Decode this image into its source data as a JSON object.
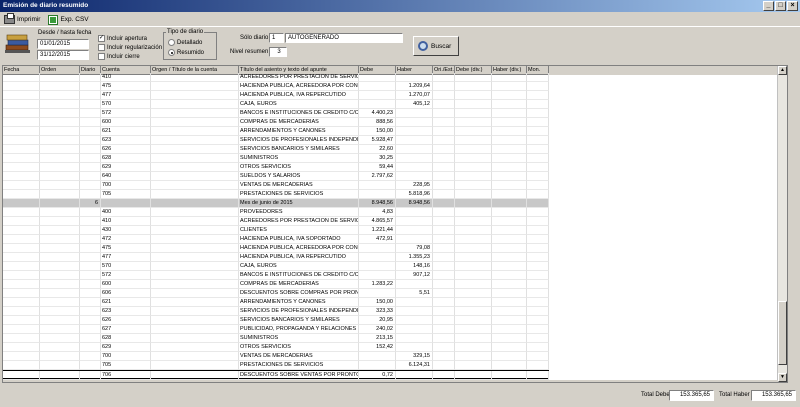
{
  "window": {
    "title": "Emisión de diario resumido"
  },
  "titlebar_buttons": [
    "_",
    "□",
    "×"
  ],
  "toolbar": {
    "print_label": "Imprimir",
    "csv_label": "Exp. CSV"
  },
  "filters": {
    "date_range_label": "Desde / hasta fecha",
    "date_from": "01/01/2015",
    "date_to": "31/12/2015",
    "include_opening_label": "Incluir apertura",
    "include_opening": true,
    "include_regularization_label": "Incluir regularización",
    "include_regularization": false,
    "include_closing_label": "Incluir cierre",
    "include_closing": false,
    "diary_type_label": "Tipo de diario",
    "type_detailed_label": "Detallado",
    "type_summary_label": "Resumido",
    "only_diary_label": "Sólo diario",
    "only_diary_value": "1",
    "only_diary_name": "AUTOGENERADO",
    "summary_level_label": "Nivel resumen",
    "summary_level_value": "3",
    "search_label": "Buscar"
  },
  "columns": [
    "Fecha",
    "Orden",
    "Diario",
    "Cuenta",
    "Orgen / Título de la cuenta",
    "Título del asiento y texto del apunte",
    "Debe",
    "Haber",
    "Ori./Est.",
    "Debe (div.)",
    "Haber (div.)",
    "Mon."
  ],
  "rows": [
    {
      "diario": "",
      "cuenta": "410",
      "titulo": "ACREEDORES POR PRESTACION DE SERVICIOS",
      "debe": "",
      "haber": "",
      "type": "normal"
    },
    {
      "diario": "",
      "cuenta": "475",
      "titulo": "HACIENDA PUBLICA, ACREEDORA POR CONCEPTOS",
      "debe": "",
      "haber": "1.209,64",
      "type": "normal"
    },
    {
      "diario": "",
      "cuenta": "477",
      "titulo": "HACIENDA PUBLICA, IVA REPERCUTIDO",
      "debe": "",
      "haber": "1.270,07",
      "type": "normal"
    },
    {
      "diario": "",
      "cuenta": "570",
      "titulo": "CAJA, EUROS",
      "debe": "",
      "haber": "405,12",
      "type": "normal"
    },
    {
      "diario": "",
      "cuenta": "572",
      "titulo": "BANCOS E INSTITUCIONES DE CREDITO C/C",
      "debe": "4.400,23",
      "haber": "",
      "type": "normal"
    },
    {
      "diario": "",
      "cuenta": "600",
      "titulo": "COMPRAS DE MERCADERIAS",
      "debe": "888,56",
      "haber": "",
      "type": "normal"
    },
    {
      "diario": "",
      "cuenta": "621",
      "titulo": "ARRENDAMIENTOS Y CANONES",
      "debe": "150,00",
      "haber": "",
      "type": "normal"
    },
    {
      "diario": "",
      "cuenta": "623",
      "titulo": "SERVICIOS DE PROFESIONALES INDEPENDIENTES",
      "debe": "5.928,47",
      "haber": "",
      "type": "normal"
    },
    {
      "diario": "",
      "cuenta": "626",
      "titulo": "SERVICIOS BANCARIOS Y SIMILARES",
      "debe": "22,60",
      "haber": "",
      "type": "normal"
    },
    {
      "diario": "",
      "cuenta": "628",
      "titulo": "SUMINISTROS",
      "debe": "30,25",
      "haber": "",
      "type": "normal"
    },
    {
      "diario": "",
      "cuenta": "629",
      "titulo": "OTROS SERVICIOS",
      "debe": "59,44",
      "haber": "",
      "type": "normal"
    },
    {
      "diario": "",
      "cuenta": "640",
      "titulo": "SUELDOS Y SALARIOS",
      "debe": "2.797,62",
      "haber": "",
      "type": "normal"
    },
    {
      "diario": "",
      "cuenta": "700",
      "titulo": "VENTAS DE MERCADERIAS",
      "debe": "",
      "haber": "228,95",
      "type": "normal"
    },
    {
      "diario": "",
      "cuenta": "705",
      "titulo": "PRESTACIONES DE SERVICIOS",
      "debe": "",
      "haber": "5.818,96",
      "type": "normal"
    },
    {
      "diario": "6",
      "cuenta": "",
      "titulo": "Mes de junio de 2015",
      "debe": "8.948,56",
      "haber": "8.948,56",
      "type": "month"
    },
    {
      "diario": "",
      "cuenta": "400",
      "titulo": "PROVEEDORES",
      "debe": "4,83",
      "haber": "",
      "type": "normal"
    },
    {
      "diario": "",
      "cuenta": "410",
      "titulo": "ACREEDORES POR PRESTACION DE SERVICIOS",
      "debe": "4.865,57",
      "haber": "",
      "type": "normal"
    },
    {
      "diario": "",
      "cuenta": "430",
      "titulo": "CLIENTES",
      "debe": "1.221,44",
      "haber": "",
      "type": "normal"
    },
    {
      "diario": "",
      "cuenta": "472",
      "titulo": "HACIENDA PUBLICA, IVA SOPORTADO",
      "debe": "472,91",
      "haber": "",
      "type": "normal"
    },
    {
      "diario": "",
      "cuenta": "475",
      "titulo": "HACIENDA PUBLICA, ACREEDORA POR CONCEPTOS",
      "debe": "",
      "haber": "79,08",
      "type": "normal"
    },
    {
      "diario": "",
      "cuenta": "477",
      "titulo": "HACIENDA PUBLICA, IVA REPERCUTIDO",
      "debe": "",
      "haber": "1.355,23",
      "type": "normal"
    },
    {
      "diario": "",
      "cuenta": "570",
      "titulo": "CAJA, EUROS",
      "debe": "",
      "haber": "148,16",
      "type": "normal"
    },
    {
      "diario": "",
      "cuenta": "572",
      "titulo": "BANCOS E INSTITUCIONES DE CREDITO C/C",
      "debe": "",
      "haber": "907,12",
      "type": "normal"
    },
    {
      "diario": "",
      "cuenta": "600",
      "titulo": "COMPRAS DE MERCADERIAS",
      "debe": "1.283,22",
      "haber": "",
      "type": "normal"
    },
    {
      "diario": "",
      "cuenta": "606",
      "titulo": "DESCUENTOS SOBRE COMPRAS POR PRONTO PAGO",
      "debe": "",
      "haber": "5,51",
      "type": "normal"
    },
    {
      "diario": "",
      "cuenta": "621",
      "titulo": "ARRENDAMIENTOS Y CANONES",
      "debe": "150,00",
      "haber": "",
      "type": "normal"
    },
    {
      "diario": "",
      "cuenta": "623",
      "titulo": "SERVICIOS DE PROFESIONALES INDEPENDIENTES",
      "debe": "323,33",
      "haber": "",
      "type": "normal"
    },
    {
      "diario": "",
      "cuenta": "626",
      "titulo": "SERVICIOS BANCARIOS Y SIMILARES",
      "debe": "20,95",
      "haber": "",
      "type": "normal"
    },
    {
      "diario": "",
      "cuenta": "627",
      "titulo": "PUBLICIDAD, PROPAGANDA Y RELACIONES PUBLICAS",
      "debe": "240,02",
      "haber": "",
      "type": "normal"
    },
    {
      "diario": "",
      "cuenta": "628",
      "titulo": "SUMINISTROS",
      "debe": "213,15",
      "haber": "",
      "type": "normal"
    },
    {
      "diario": "",
      "cuenta": "629",
      "titulo": "OTROS SERVICIOS",
      "debe": "152,42",
      "haber": "",
      "type": "normal"
    },
    {
      "diario": "",
      "cuenta": "700",
      "titulo": "VENTAS DE MERCADERIAS",
      "debe": "",
      "haber": "329,15",
      "type": "normal"
    },
    {
      "diario": "",
      "cuenta": "705",
      "titulo": "PRESTACIONES DE SERVICIOS",
      "debe": "",
      "haber": "6.124,31",
      "type": "normal"
    },
    {
      "diario": "",
      "cuenta": "706",
      "titulo": "DESCUENTOS SOBRE VENTAS POR PRONTO PAGO",
      "debe": "0,72",
      "haber": "",
      "type": "selected"
    }
  ],
  "totals": {
    "debe_label": "Total Debe",
    "debe_value": "153.365,65",
    "haber_label": "Total Haber",
    "haber_value": "153.365,65"
  },
  "scrollbar": {
    "position": 0.97
  }
}
